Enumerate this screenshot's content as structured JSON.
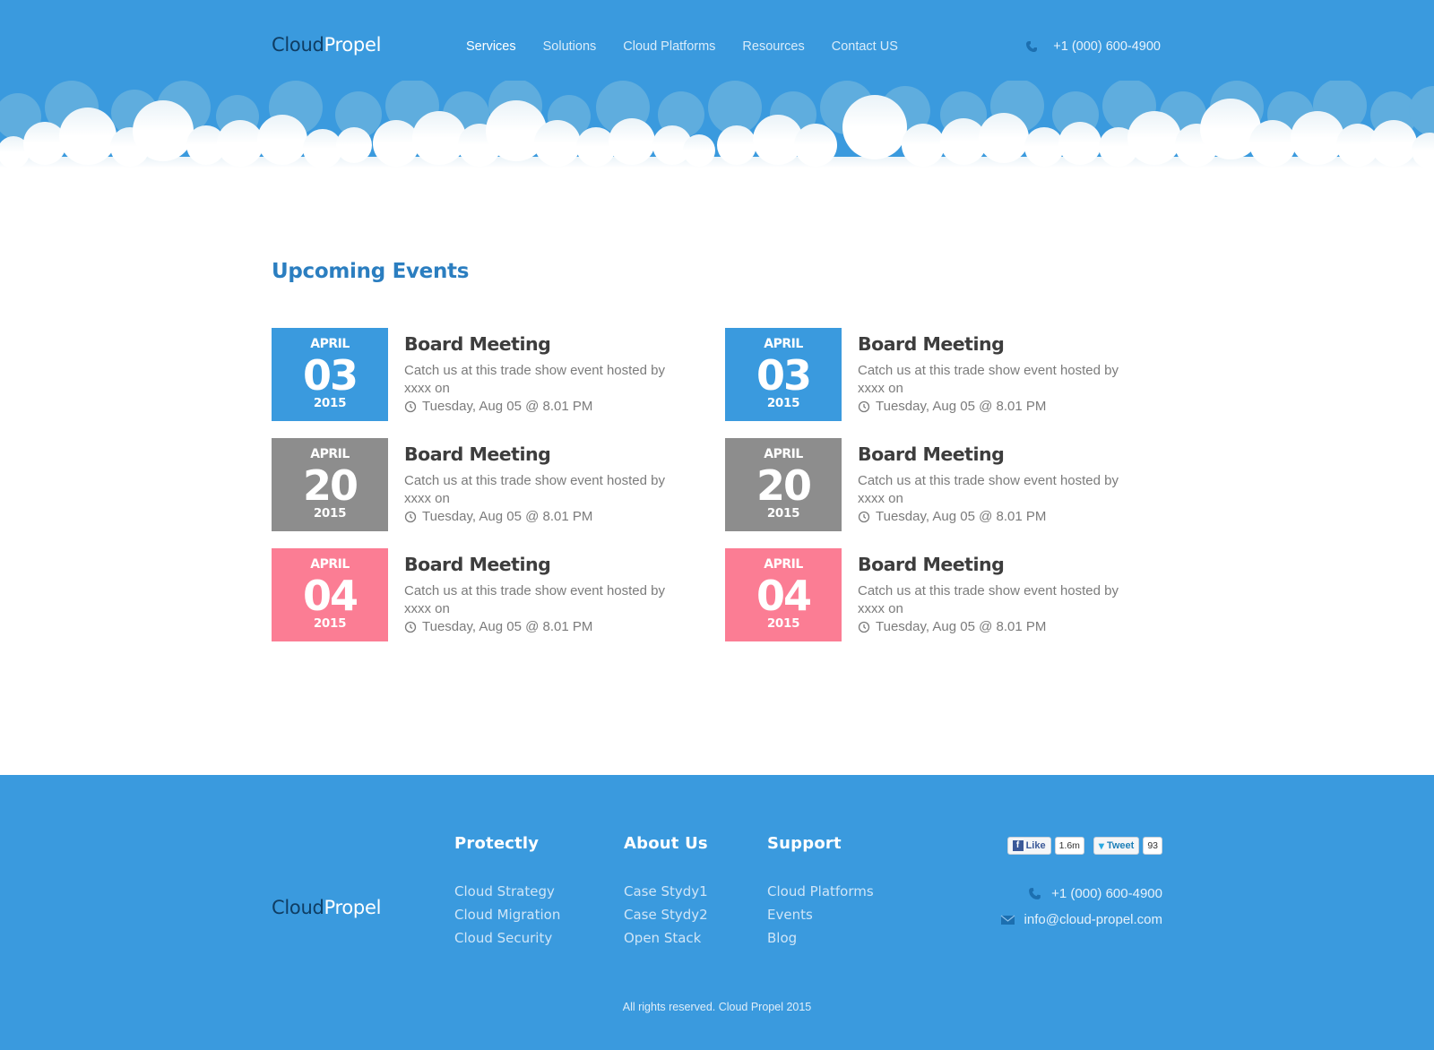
{
  "brand": {
    "part1": "Cloud",
    "part2": "Propel"
  },
  "nav": [
    {
      "label": "Services",
      "active": true
    },
    {
      "label": "Solutions"
    },
    {
      "label": "Cloud Platforms"
    },
    {
      "label": "Resources"
    },
    {
      "label": "Contact US"
    }
  ],
  "header_phone": "+1 (000) 600-4900",
  "section_title": "Upcoming Events",
  "events": [
    {
      "month": "APRIL",
      "day": "03",
      "year": "2015",
      "title": "Board Meeting",
      "desc": "Catch us at this trade show event hosted by xxxx on",
      "time": "Tuesday, Aug 05 @ 8.01 PM",
      "color": "#3a9ade"
    },
    {
      "month": "APRIL",
      "day": "03",
      "year": "2015",
      "title": "Board Meeting",
      "desc": "Catch us at this trade show event hosted by xxxx on",
      "time": "Tuesday, Aug 05 @ 8.01 PM",
      "color": "#3a9ade"
    },
    {
      "month": "APRIL",
      "day": "20",
      "year": "2015",
      "title": "Board Meeting",
      "desc": "Catch us at this trade show event hosted by xxxx on",
      "time": "Tuesday, Aug 05 @ 8.01 PM",
      "color": "#8d8d8d"
    },
    {
      "month": "APRIL",
      "day": "20",
      "year": "2015",
      "title": "Board Meeting",
      "desc": "Catch us at this trade show event hosted by xxxx on",
      "time": "Tuesday, Aug 05 @ 8.01 PM",
      "color": "#8d8d8d"
    },
    {
      "month": "APRIL",
      "day": "04",
      "year": "2015",
      "title": "Board Meeting",
      "desc": "Catch us at this trade show event hosted by xxxx on",
      "time": "Tuesday, Aug 05 @ 8.01 PM",
      "color": "#fb7d94"
    },
    {
      "month": "APRIL",
      "day": "04",
      "year": "2015",
      "title": "Board Meeting",
      "desc": "Catch us at this trade show event hosted by xxxx on",
      "time": "Tuesday, Aug 05 @ 8.01 PM",
      "color": "#fb7d94"
    }
  ],
  "footer": {
    "columns": [
      {
        "heading": "Protectly",
        "links": [
          "Cloud Strategy",
          "Cloud Migration",
          "Cloud Security"
        ]
      },
      {
        "heading": "About Us",
        "links": [
          "Case Stydy1",
          "Case Stydy2",
          "Open Stack"
        ]
      },
      {
        "heading": "Support",
        "links": [
          "Cloud Platforms",
          "Events",
          "Blog"
        ]
      }
    ],
    "social": {
      "like_label": "Like",
      "like_count": "1.6m",
      "tweet_label": "Tweet",
      "tweet_count": "93"
    },
    "phone": "+1 (000) 600-4900",
    "email": "info@cloud-propel.com",
    "copyright": "All rights reserved. Cloud Propel 2015"
  },
  "colors": {
    "primary": "#3a9ade",
    "brand_dark": "#0f3d63",
    "heading": "#2b7ec0",
    "gray": "#8d8d8d",
    "pink": "#fb7d94"
  },
  "icons": {
    "phone": "phone-icon",
    "clock": "clock-icon",
    "mail": "mail-icon",
    "facebook": "facebook-icon",
    "twitter": "twitter-icon"
  }
}
